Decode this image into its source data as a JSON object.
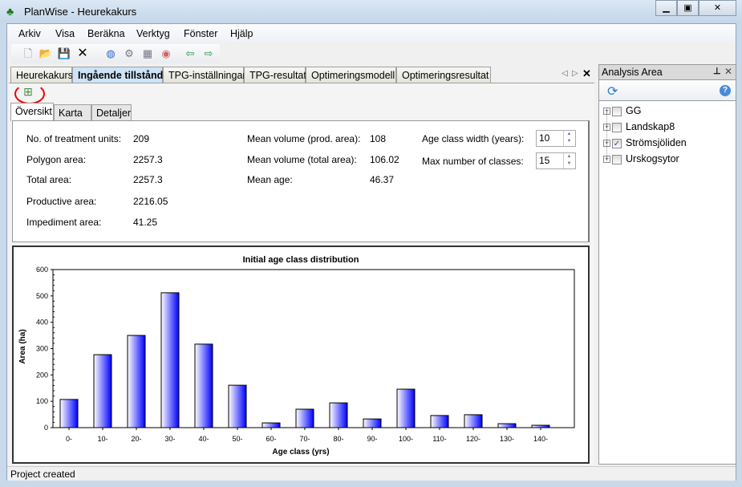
{
  "window": {
    "title": "PlanWise - Heurekakurs",
    "controls": [
      "minimize",
      "maximize",
      "close"
    ]
  },
  "menu": [
    "Arkiv",
    "Visa",
    "Beräkna",
    "Verktyg",
    "Fönster",
    "Hjälp"
  ],
  "toolbar": [
    "new-icon",
    "open-icon",
    "save-icon",
    "delete-icon",
    "globe-icon",
    "gears-icon",
    "grid-gear-icon",
    "palette-icon",
    "import-icon",
    "export-icon"
  ],
  "doc_tabs": [
    {
      "label": "Heurekakurs",
      "active": false
    },
    {
      "label": "Ingående tillstånd",
      "active": true
    },
    {
      "label": "TPG-inställningar",
      "active": false
    },
    {
      "label": "TPG-resultat",
      "active": false
    },
    {
      "label": "Optimeringsmodell",
      "active": false
    },
    {
      "label": "Optimeringsresultat",
      "active": false
    }
  ],
  "sub_tabs": [
    {
      "label": "Översikt",
      "active": true
    },
    {
      "label": "Karta",
      "active": false
    },
    {
      "label": "Detaljer",
      "active": false
    }
  ],
  "stats": {
    "col1": [
      {
        "label": "No. of treatment units:",
        "value": "209"
      },
      {
        "label": "Polygon area:",
        "value": "2257.3"
      },
      {
        "label": "Total area:",
        "value": "2257.3"
      },
      {
        "label": "Productive area:",
        "value": "2216.05"
      },
      {
        "label": "Impediment area:",
        "value": "41.25"
      }
    ],
    "col2": [
      {
        "label": "Mean volume (prod. area):",
        "value": "108"
      },
      {
        "label": "Mean volume (total area):",
        "value": "106.02"
      },
      {
        "label": "Mean age:",
        "value": "46.37"
      }
    ],
    "settings": [
      {
        "label": "Age class width (years):",
        "value": "10"
      },
      {
        "label": "Max number of classes:",
        "value": "15"
      }
    ]
  },
  "chart_data": {
    "type": "bar",
    "title": "Initial age class distribution",
    "xlabel": "Age class (yrs)",
    "ylabel": "Area (ha)",
    "ylim": [
      0,
      600
    ],
    "yticks": [
      0,
      100,
      200,
      300,
      400,
      500,
      600
    ],
    "categories": [
      "0-",
      "10-",
      "20-",
      "30-",
      "40-",
      "50-",
      "60-",
      "70-",
      "80-",
      "90-",
      "100-",
      "110-",
      "120-",
      "130-",
      "140-"
    ],
    "values": [
      107,
      277,
      350,
      512,
      317,
      161,
      18,
      70,
      94,
      33,
      146,
      46,
      49,
      15,
      9
    ],
    "bar_color_start": "#ffffff",
    "bar_color_end": "#0000ff"
  },
  "analysis_area": {
    "title": "Analysis Area",
    "items": [
      {
        "label": "GG",
        "checked": false
      },
      {
        "label": "Landskap8",
        "checked": false
      },
      {
        "label": "Strömsjöliden",
        "checked": true
      },
      {
        "label": "Urskogsytor",
        "checked": false
      }
    ]
  },
  "status": "Project created"
}
